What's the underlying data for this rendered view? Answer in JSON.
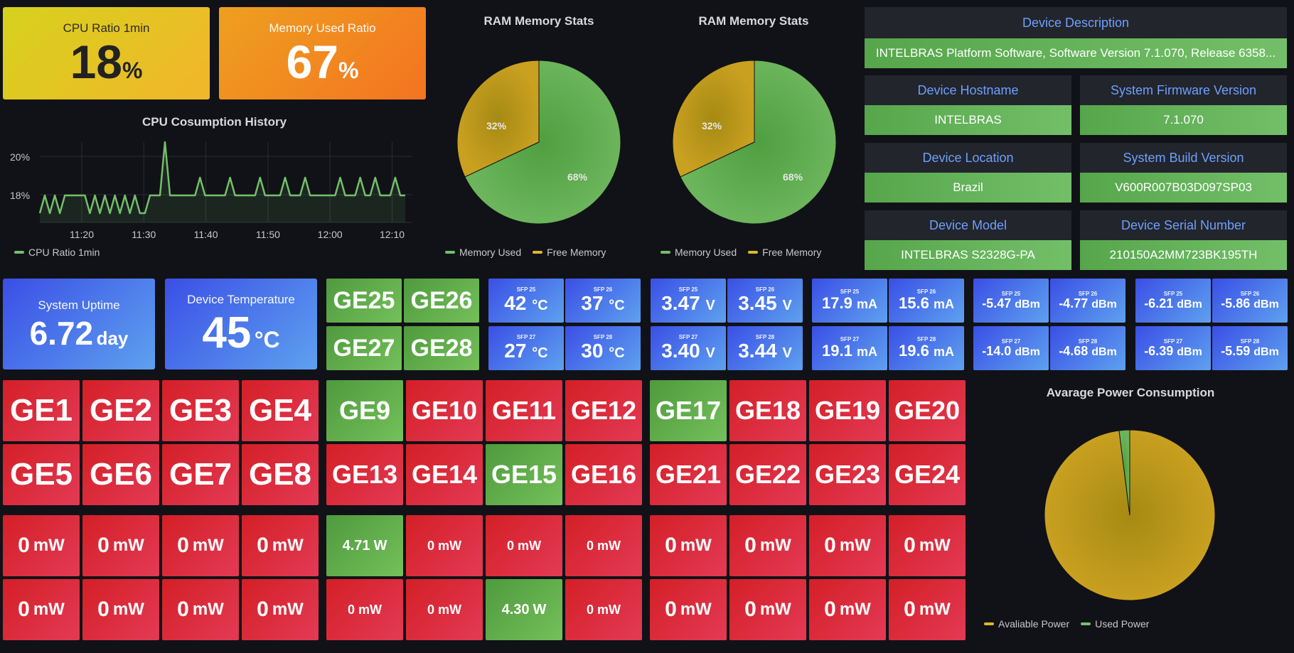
{
  "colors": {
    "green": "#73bf69",
    "yellow": "#cfa51b",
    "red": "#e02f44",
    "blue": "#3d71d9"
  },
  "cpu_ratio": {
    "title": "CPU Ratio 1min",
    "value": "18",
    "unit": "%"
  },
  "mem_ratio": {
    "title": "Memory Used Ratio",
    "value": "67",
    "unit": "%"
  },
  "cpu_history": {
    "title": "CPU Cosumption History",
    "legend": "CPU Ratio 1min",
    "y_ticks": [
      "20%",
      "18%"
    ],
    "x_ticks": [
      "11:20",
      "11:30",
      "11:40",
      "11:50",
      "12:00",
      "12:10"
    ]
  },
  "ram1": {
    "title": "RAM Memory Stats",
    "used_pct": "68%",
    "free_pct": "32%",
    "legend_used": "Memory Used",
    "legend_free": "Free Memory"
  },
  "ram2": {
    "title": "RAM Memory Stats",
    "used_pct": "68%",
    "free_pct": "32%",
    "legend_used": "Memory Used",
    "legend_free": "Free Memory"
  },
  "device": {
    "description_label": "Device Description",
    "description": "INTELBRAS Platform Software, Software Version 7.1.070, Release 6358...",
    "hostname_label": "Device Hostname",
    "hostname": "INTELBRAS",
    "firmware_label": "System Firmware Version",
    "firmware": "7.1.070",
    "location_label": "Device Location",
    "location": "Brazil",
    "build_label": "System Build Version",
    "build": "V600R007B03D097SP03",
    "model_label": "Device Model",
    "model": "INTELBRAS S2328G-PA",
    "serial_label": "Device Serial Number",
    "serial": "210150A2MM723BK195TH"
  },
  "uptime": {
    "title": "System Uptime",
    "value": "6.72",
    "unit": "day"
  },
  "temperature": {
    "title": "Device Temperature",
    "value": "45",
    "unit": "°C"
  },
  "ge_sfp_ports": [
    "GE25",
    "GE26",
    "GE27",
    "GE28"
  ],
  "sfp_groups": [
    {
      "name": "temperature",
      "items": [
        {
          "label": "SFP 25",
          "value": "42",
          "unit": "°C"
        },
        {
          "label": "SFP 26",
          "value": "37",
          "unit": "°C"
        },
        {
          "label": "SFP 27",
          "value": "27",
          "unit": "°C"
        },
        {
          "label": "SFP 28",
          "value": "30",
          "unit": "°C"
        }
      ]
    },
    {
      "name": "voltage",
      "items": [
        {
          "label": "SFP 25",
          "value": "3.47",
          "unit": "V"
        },
        {
          "label": "SFP 26",
          "value": "3.45",
          "unit": "V"
        },
        {
          "label": "SFP 27",
          "value": "3.40",
          "unit": "V"
        },
        {
          "label": "SFP 28",
          "value": "3.44",
          "unit": "V"
        }
      ]
    },
    {
      "name": "bias",
      "items": [
        {
          "label": "SFP 25",
          "value": "17.9",
          "unit": "mA"
        },
        {
          "label": "SFP 26",
          "value": "15.6",
          "unit": "mA"
        },
        {
          "label": "SFP 27",
          "value": "19.1",
          "unit": "mA"
        },
        {
          "label": "SFP 28",
          "value": "19.6",
          "unit": "mA"
        }
      ]
    },
    {
      "name": "tx_power",
      "items": [
        {
          "label": "SFP 25",
          "value": "-5.47",
          "unit": "dBm"
        },
        {
          "label": "SFP 26",
          "value": "-4.77",
          "unit": "dBm"
        },
        {
          "label": "SFP 27",
          "value": "-14.0",
          "unit": "dBm"
        },
        {
          "label": "SFP 28",
          "value": "-4.68",
          "unit": "dBm"
        }
      ]
    },
    {
      "name": "rx_power",
      "items": [
        {
          "label": "SFP 25",
          "value": "-6.21",
          "unit": "dBm"
        },
        {
          "label": "SFP 26",
          "value": "-5.86",
          "unit": "dBm"
        },
        {
          "label": "SFP 27",
          "value": "-6.39",
          "unit": "dBm"
        },
        {
          "label": "SFP 28",
          "value": "-5.59",
          "unit": "dBm"
        }
      ]
    }
  ],
  "port_groups": [
    {
      "ports": [
        {
          "name": "GE1",
          "up": false
        },
        {
          "name": "GE2",
          "up": false
        },
        {
          "name": "GE3",
          "up": false
        },
        {
          "name": "GE4",
          "up": false
        },
        {
          "name": "GE5",
          "up": false
        },
        {
          "name": "GE6",
          "up": false
        },
        {
          "name": "GE7",
          "up": false
        },
        {
          "name": "GE8",
          "up": false
        }
      ]
    },
    {
      "ports": [
        {
          "name": "GE9",
          "up": true
        },
        {
          "name": "GE10",
          "up": false
        },
        {
          "name": "GE11",
          "up": false
        },
        {
          "name": "GE12",
          "up": false
        },
        {
          "name": "GE13",
          "up": false
        },
        {
          "name": "GE14",
          "up": false
        },
        {
          "name": "GE15",
          "up": true
        },
        {
          "name": "GE16",
          "up": false
        }
      ]
    },
    {
      "ports": [
        {
          "name": "GE17",
          "up": true
        },
        {
          "name": "GE18",
          "up": false
        },
        {
          "name": "GE19",
          "up": false
        },
        {
          "name": "GE20",
          "up": false
        },
        {
          "name": "GE21",
          "up": false
        },
        {
          "name": "GE22",
          "up": false
        },
        {
          "name": "GE23",
          "up": false
        },
        {
          "name": "GE24",
          "up": false
        }
      ]
    }
  ],
  "power_groups": [
    {
      "items": [
        {
          "value": "0",
          "unit": "mW",
          "on": false
        },
        {
          "value": "0",
          "unit": "mW",
          "on": false
        },
        {
          "value": "0",
          "unit": "mW",
          "on": false
        },
        {
          "value": "0",
          "unit": "mW",
          "on": false
        },
        {
          "value": "0",
          "unit": "mW",
          "on": false
        },
        {
          "value": "0",
          "unit": "mW",
          "on": false
        },
        {
          "value": "0",
          "unit": "mW",
          "on": false
        },
        {
          "value": "0",
          "unit": "mW",
          "on": false
        }
      ]
    },
    {
      "items": [
        {
          "value": "4.71",
          "unit": "W",
          "on": true
        },
        {
          "value": "0",
          "unit": "mW",
          "on": false
        },
        {
          "value": "0",
          "unit": "mW",
          "on": false
        },
        {
          "value": "0",
          "unit": "mW",
          "on": false
        },
        {
          "value": "0",
          "unit": "mW",
          "on": false
        },
        {
          "value": "0",
          "unit": "mW",
          "on": false
        },
        {
          "value": "4.30",
          "unit": "W",
          "on": true
        },
        {
          "value": "0",
          "unit": "mW",
          "on": false
        }
      ]
    },
    {
      "items": [
        {
          "value": "0",
          "unit": "mW",
          "on": false
        },
        {
          "value": "0",
          "unit": "mW",
          "on": false
        },
        {
          "value": "0",
          "unit": "mW",
          "on": false
        },
        {
          "value": "0",
          "unit": "mW",
          "on": false
        },
        {
          "value": "0",
          "unit": "mW",
          "on": false
        },
        {
          "value": "0",
          "unit": "mW",
          "on": false
        },
        {
          "value": "0",
          "unit": "mW",
          "on": false
        },
        {
          "value": "0",
          "unit": "mW",
          "on": false
        }
      ]
    }
  ],
  "power_pie": {
    "title": "Avarage Power Consumption",
    "legend_available": "Avaliable Power",
    "legend_used": "Used Power"
  },
  "chart_data": [
    {
      "type": "line",
      "title": "CPU Cosumption History",
      "x_ticks": [
        "11:20",
        "11:30",
        "11:40",
        "11:50",
        "12:00",
        "12:10"
      ],
      "y_ticks": [
        "20%",
        "18%"
      ],
      "ylim": [
        17,
        21
      ],
      "series": [
        {
          "name": "CPU Ratio 1min",
          "values": [
            17,
            18,
            17,
            18,
            17,
            18,
            18,
            18,
            18,
            18,
            17,
            18,
            17,
            18,
            17,
            18,
            17,
            18,
            17,
            18,
            17,
            17,
            18,
            18,
            18,
            21,
            18,
            18,
            18,
            18,
            18,
            18,
            19,
            18,
            18,
            18,
            18,
            18,
            19,
            18,
            18,
            18,
            18,
            18,
            19,
            18,
            18,
            18,
            18,
            19,
            18,
            18,
            18,
            19,
            18,
            18,
            18,
            18,
            18,
            18,
            19,
            18,
            18,
            18,
            19,
            18,
            18,
            19,
            18,
            18,
            18,
            19,
            18,
            18
          ]
        }
      ]
    },
    {
      "type": "pie",
      "title": "RAM Memory Stats",
      "series": [
        {
          "name": "Memory Used",
          "values": [
            68
          ]
        },
        {
          "name": "Free Memory",
          "values": [
            32
          ]
        }
      ]
    },
    {
      "type": "pie",
      "title": "RAM Memory Stats",
      "series": [
        {
          "name": "Memory Used",
          "values": [
            68
          ]
        },
        {
          "name": "Free Memory",
          "values": [
            32
          ]
        }
      ]
    },
    {
      "type": "pie",
      "title": "Avarage Power Consumption",
      "series": [
        {
          "name": "Avaliable Power",
          "values": [
            98
          ]
        },
        {
          "name": "Used Power",
          "values": [
            2
          ]
        }
      ]
    }
  ]
}
